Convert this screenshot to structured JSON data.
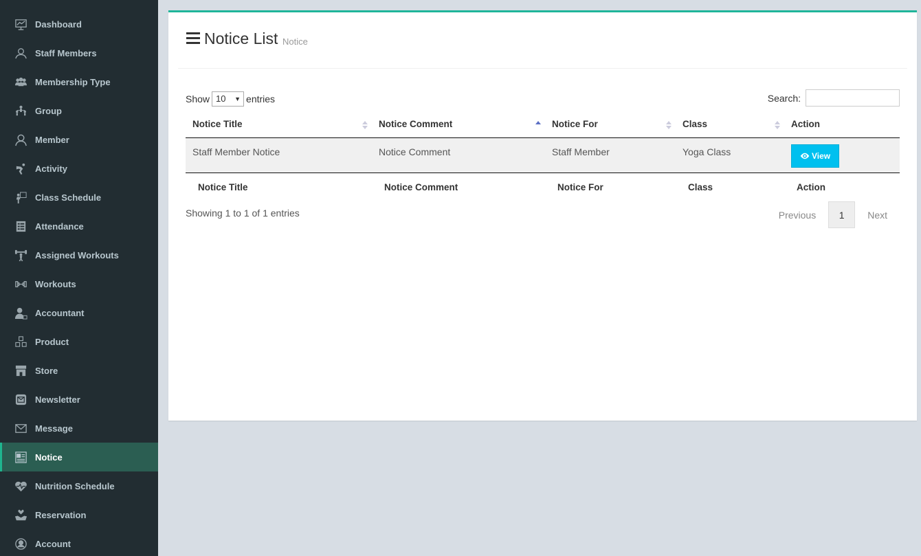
{
  "sidebar": {
    "items": [
      {
        "label": "Dashboard",
        "icon": "dashboard-icon"
      },
      {
        "label": "Staff Members",
        "icon": "staff-icon"
      },
      {
        "label": "Membership Type",
        "icon": "membership-icon"
      },
      {
        "label": "Group",
        "icon": "group-icon"
      },
      {
        "label": "Member",
        "icon": "member-icon"
      },
      {
        "label": "Activity",
        "icon": "activity-icon"
      },
      {
        "label": "Class Schedule",
        "icon": "class-schedule-icon"
      },
      {
        "label": "Attendance",
        "icon": "attendance-icon"
      },
      {
        "label": "Assigned Workouts",
        "icon": "assigned-workouts-icon"
      },
      {
        "label": "Workouts",
        "icon": "workouts-icon"
      },
      {
        "label": "Accountant",
        "icon": "accountant-icon"
      },
      {
        "label": "Product",
        "icon": "product-icon"
      },
      {
        "label": "Store",
        "icon": "store-icon"
      },
      {
        "label": "Newsletter",
        "icon": "newsletter-icon"
      },
      {
        "label": "Message",
        "icon": "message-icon"
      },
      {
        "label": "Notice",
        "icon": "notice-icon",
        "active": true
      },
      {
        "label": "Nutrition Schedule",
        "icon": "nutrition-icon"
      },
      {
        "label": "Reservation",
        "icon": "reservation-icon"
      },
      {
        "label": "Account",
        "icon": "account-icon"
      }
    ]
  },
  "header": {
    "title": "Notice List",
    "subtitle": "Notice"
  },
  "controls": {
    "show_label": "Show",
    "entries_value": "10",
    "entries_label": "entries",
    "search_label": "Search:",
    "search_value": ""
  },
  "table": {
    "columns": [
      "Notice Title",
      "Notice Comment",
      "Notice For",
      "Class",
      "Action"
    ],
    "rows": [
      {
        "title": "Staff Member Notice",
        "comment": "Notice Comment",
        "for": "Staff Member",
        "class": "Yoga Class",
        "action": "View"
      }
    ]
  },
  "footer": {
    "info": "Showing 1 to 1 of 1 entries",
    "previous": "Previous",
    "page": "1",
    "next": "Next"
  },
  "colors": {
    "sidebar_bg": "#222d32",
    "active_bg": "#2b5e52",
    "accent": "#1fb59a",
    "view_button": "#00c0ef"
  }
}
